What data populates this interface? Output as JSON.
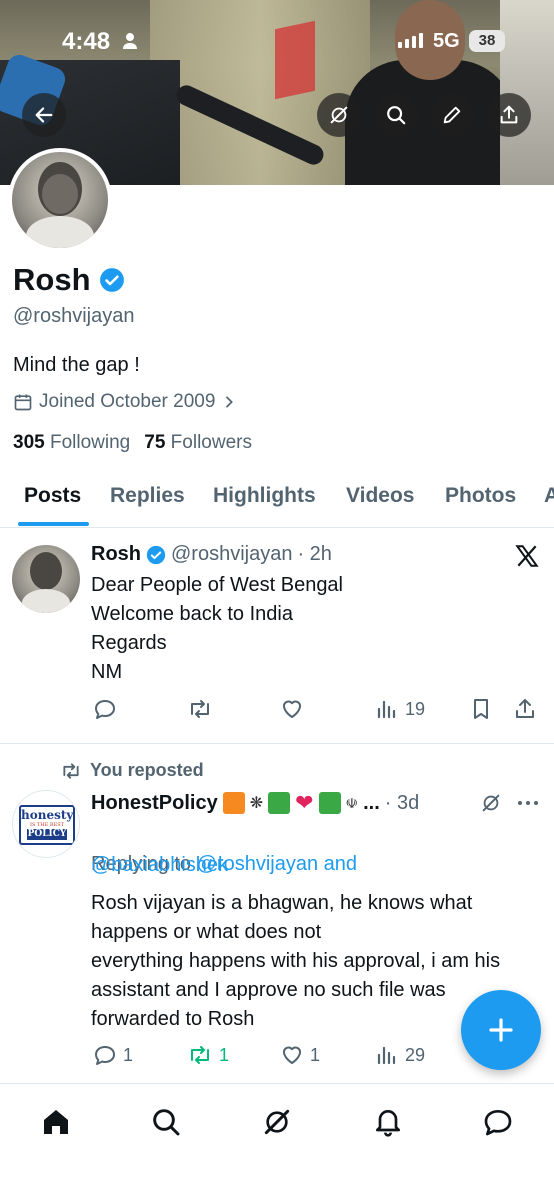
{
  "status_bar": {
    "time": "4:48",
    "network": "5G",
    "battery": "38"
  },
  "profile": {
    "name": "Rosh",
    "handle": "@roshvijayan",
    "bio": "Mind the gap !",
    "joined": "Joined October 2009",
    "following_count": "305",
    "following_label": "Following",
    "followers_count": "75",
    "followers_label": "Followers"
  },
  "tabs": [
    "Posts",
    "Replies",
    "Highlights",
    "Videos",
    "Photos",
    "A"
  ],
  "tweets": [
    {
      "name": "Rosh",
      "handle": "@roshvijayan",
      "time": "· 2h",
      "text": "Dear People of West Bengal\nWelcome back to India\nRegards\nNM",
      "views": "19"
    },
    {
      "repost_label": "You reposted",
      "name": "HonestPolicy",
      "name_suffix": "...",
      "time": "· 3d",
      "replying_prefix": "Replying to",
      "replying_to": "@roshvijayan and",
      "replying_to2": "@baxiabhishek",
      "text": "Rosh vijayan is a bhagwan, he knows what happens or what does not\neverything happens with his approval, i am his assistant and I approve no such file was forwarded to Rosh",
      "replies": "1",
      "reposts": "1",
      "likes": "1",
      "views": "29",
      "avatar_text_1": "honesty",
      "avatar_text_2": "IS THE BEST",
      "avatar_text_3": "POLICY"
    }
  ],
  "colors": {
    "accent": "#1d9bf0",
    "text": "#0f1419",
    "muted": "#536471",
    "repost_green": "#00ba7c"
  },
  "icons": [
    "back-arrow-icon",
    "grok-icon",
    "search-icon",
    "edit-icon",
    "share-icon",
    "calendar-icon",
    "chevron-right-icon",
    "verified-icon",
    "x-logo-icon",
    "reply-icon",
    "repost-icon",
    "like-icon",
    "views-icon",
    "bookmark-icon",
    "more-icon",
    "compose-plus-icon",
    "home-icon",
    "bell-icon",
    "messages-icon"
  ]
}
